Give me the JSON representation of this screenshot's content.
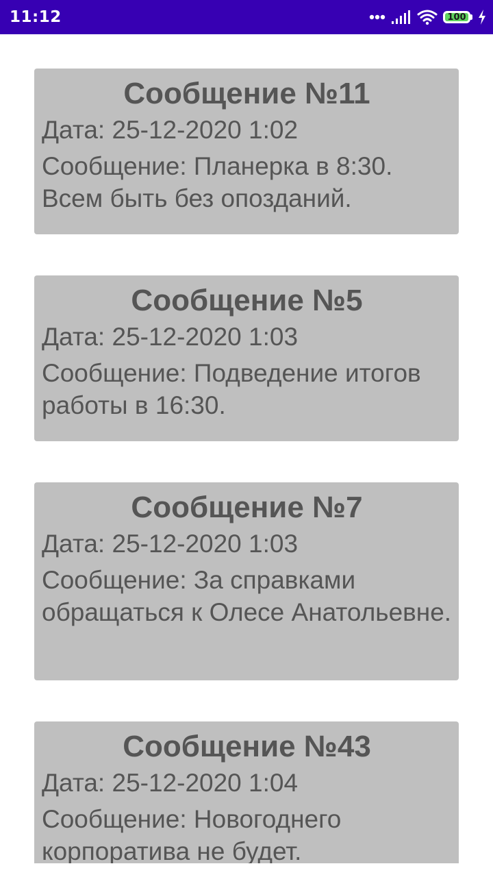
{
  "status_bar": {
    "time": "11:12",
    "battery_level": "100",
    "icons": [
      "more-dots-icon",
      "signal-icon",
      "wifi-icon",
      "battery-icon",
      "charging-bolt-icon"
    ],
    "colors": {
      "background": "#3700b3",
      "battery_fill": "#5fd35f"
    }
  },
  "messages": [
    {
      "title": "Сообщение №11",
      "date": "Дата: 25-12-2020 1:02",
      "text": "Сообщение: Планерка в 8:30. Всем быть без опозданий."
    },
    {
      "title": "Сообщение №5",
      "date": "Дата: 25-12-2020 1:03",
      "text": "Сообщение: Подведение итогов работы в 16:30."
    },
    {
      "title": "Сообщение №7",
      "date": "Дата: 25-12-2020 1:03",
      "text": "Сообщение: За справками обращаться к Олесе Анатольевне."
    },
    {
      "title": "Сообщение №43",
      "date": "Дата: 25-12-2020 1:04",
      "text": "Сообщение: Новогоднего корпоратива не будет."
    }
  ],
  "theme": {
    "card_background": "#bfbfbf",
    "card_text": "#555555",
    "page_background": "#ffffff"
  }
}
